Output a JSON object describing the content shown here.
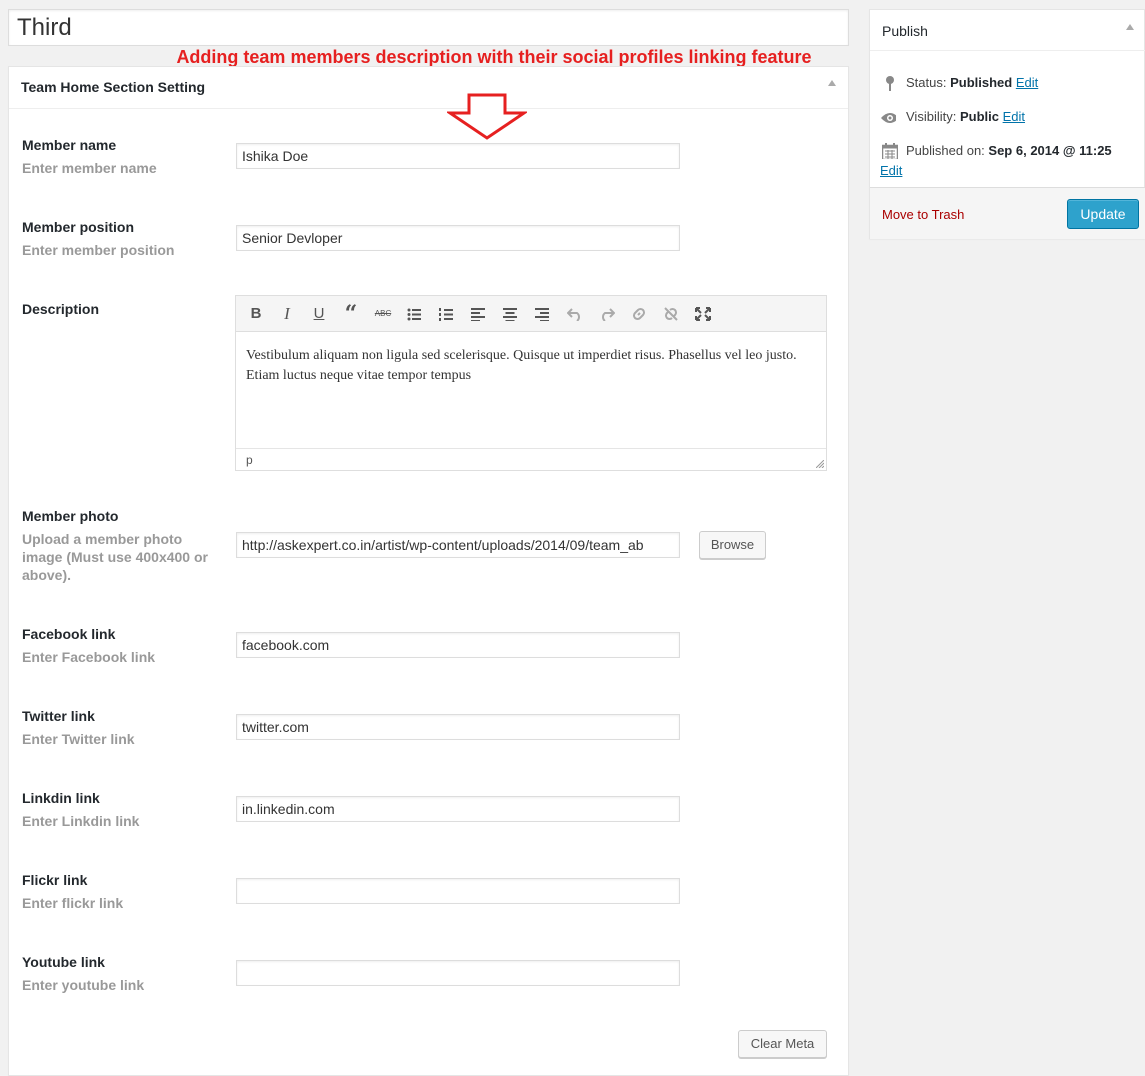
{
  "post": {
    "title": "Third"
  },
  "annotation": {
    "text": "Adding team members description with their social profiles linking feature"
  },
  "metabox": {
    "title": "Team Home Section Setting",
    "fields": {
      "member_name": {
        "label": "Member name",
        "help": "Enter member name",
        "value": "Ishika Doe"
      },
      "member_position": {
        "label": "Member position",
        "help": "Enter member position",
        "value": "Senior Devloper"
      },
      "description": {
        "label": "Description",
        "content": "Vestibulum aliquam non ligula sed scelerisque. Quisque ut imperdiet risus. Phasellus vel leo justo. Etiam luctus neque vitae tempor tempus",
        "status_path": "p",
        "toolbar": [
          "bold-icon",
          "italic-icon",
          "underline-icon",
          "blockquote-icon",
          "strikethrough-icon",
          "bullet-list-icon",
          "numbered-list-icon",
          "align-left-icon",
          "align-center-icon",
          "align-right-icon",
          "undo-icon",
          "redo-icon",
          "link-icon",
          "unlink-icon",
          "fullscreen-icon"
        ]
      },
      "member_photo": {
        "label": "Member photo",
        "help": "Upload a member photo image (Must use 400x400 or above).",
        "value": "http://askexpert.co.in/artist/wp-content/uploads/2014/09/team_ab",
        "browse_label": "Browse"
      },
      "facebook": {
        "label": "Facebook link",
        "help": "Enter Facebook link",
        "value": "facebook.com"
      },
      "twitter": {
        "label": "Twitter link",
        "help": "Enter Twitter link",
        "value": "twitter.com"
      },
      "linkedin": {
        "label": "Linkdin link",
        "help": "Enter Linkdin link",
        "value": "in.linkedin.com"
      },
      "flickr": {
        "label": "Flickr link",
        "help": "Enter flickr link",
        "value": ""
      },
      "youtube": {
        "label": "Youtube link",
        "help": "Enter youtube link",
        "value": ""
      }
    },
    "clear_meta_label": "Clear Meta"
  },
  "publish": {
    "title": "Publish",
    "status_label": "Status:",
    "status_value": "Published",
    "visibility_label": "Visibility:",
    "visibility_value": "Public",
    "published_on_label": "Published on:",
    "published_on_value": "Sep 6, 2014 @ 11:25",
    "edit_label": "Edit",
    "trash_label": "Move to Trash",
    "update_label": "Update"
  },
  "colors": {
    "annotation": "#e62020",
    "primary_button": "#2ea2cc",
    "link": "#0073aa",
    "trash": "#aa0000"
  }
}
